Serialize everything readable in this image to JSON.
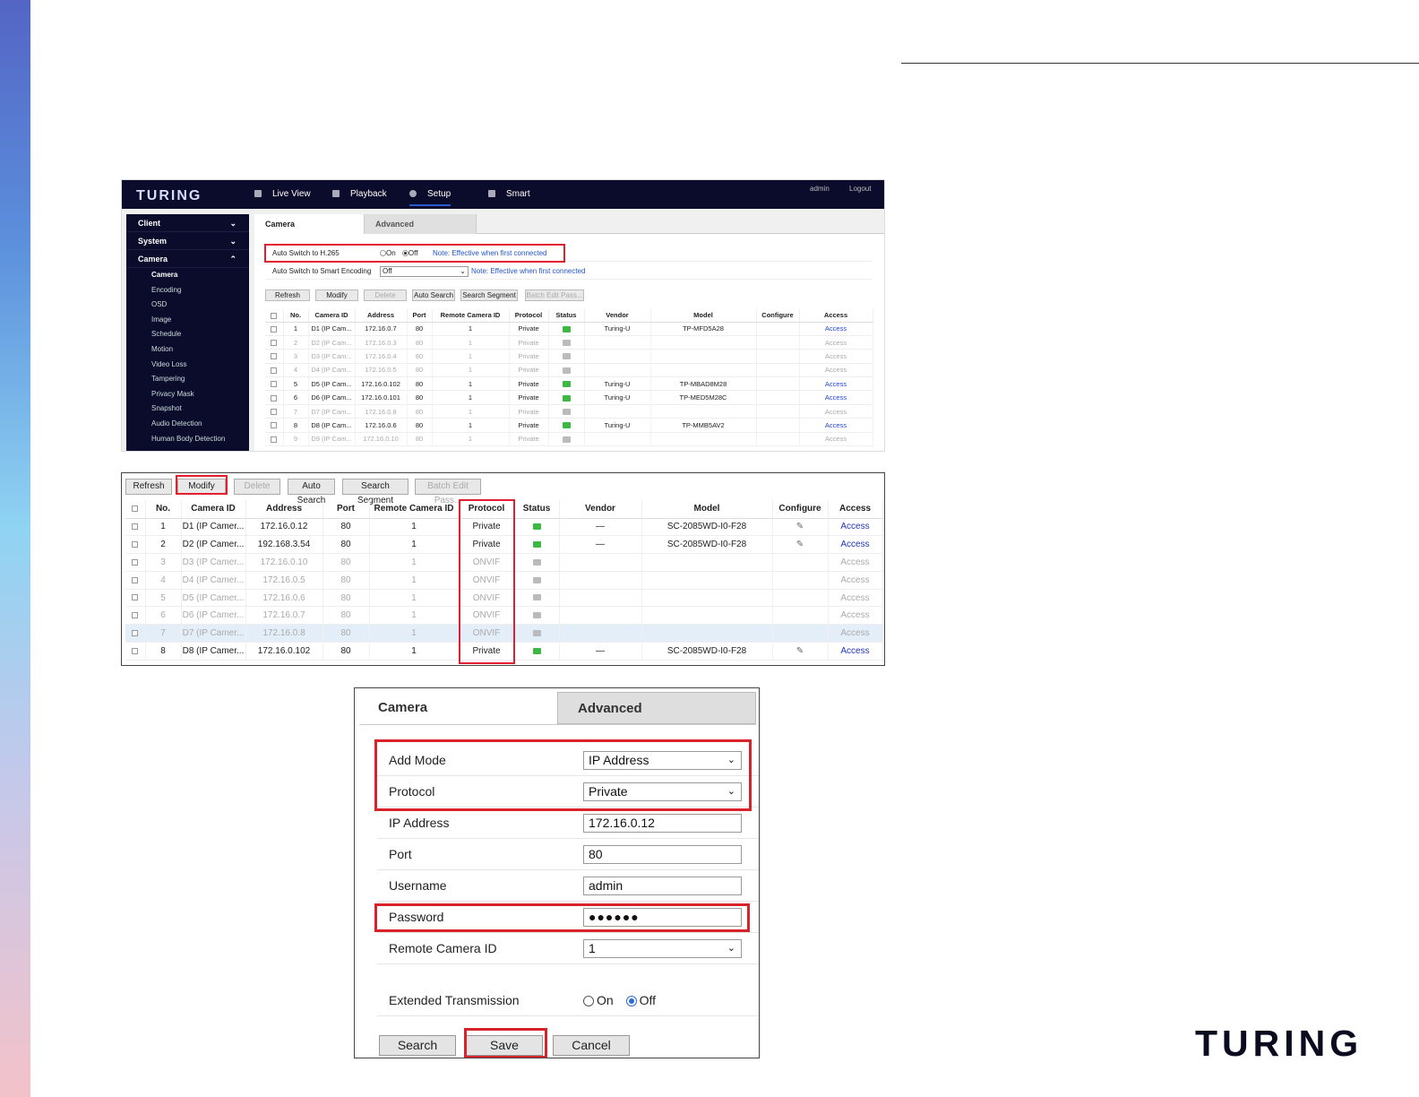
{
  "panel1": {
    "logo": "TURING",
    "nav": [
      "Live View",
      "Playback",
      "Setup",
      "Smart"
    ],
    "header_right": [
      "admin",
      "Logout"
    ],
    "sidebar": {
      "sections": [
        "Client",
        "System",
        "Camera"
      ],
      "camera_items": [
        "Camera",
        "Encoding",
        "OSD",
        "Image",
        "Schedule",
        "Motion",
        "Video Loss",
        "Tampering",
        "Privacy Mask",
        "Snapshot",
        "Audio Detection",
        "Human Body Detection"
      ]
    },
    "tabs": [
      "Camera",
      "Advanced"
    ],
    "settings": {
      "h265_label": "Auto Switch to H.265",
      "on": "On",
      "off": "Off",
      "note": "Note: Effective when first connected",
      "smart_label": "Auto Switch to Smart Encoding",
      "smart_value": "Off"
    },
    "toolbar": [
      "Refresh",
      "Modify",
      "Delete",
      "Auto Search",
      "Search Segment",
      "Batch Edit Pass..."
    ],
    "columns": [
      "",
      "No.",
      "Camera ID",
      "Address",
      "Port",
      "Remote Camera ID",
      "Protocol",
      "Status",
      "Vendor",
      "Model",
      "Configure",
      "Access"
    ],
    "rows": [
      {
        "no": "1",
        "id": "D1 (IP Cam...",
        "address": "172.16.0.7",
        "port": "80",
        "rid": "1",
        "protocol": "Private",
        "vendor": "Turing-U",
        "model": "TP-MFD5A28",
        "access": "Access",
        "active": true
      },
      {
        "no": "2",
        "id": "D2 (IP Cam...",
        "address": "172.16.0.3",
        "port": "80",
        "rid": "1",
        "protocol": "Private",
        "vendor": "",
        "model": "",
        "access": "Access",
        "active": false
      },
      {
        "no": "3",
        "id": "D3 (IP Cam...",
        "address": "172.16.0.4",
        "port": "80",
        "rid": "1",
        "protocol": "Private",
        "vendor": "",
        "model": "",
        "access": "Access",
        "active": false
      },
      {
        "no": "4",
        "id": "D4 (IP Cam...",
        "address": "172.16.0.5",
        "port": "80",
        "rid": "1",
        "protocol": "Private",
        "vendor": "",
        "model": "",
        "access": "Access",
        "active": false
      },
      {
        "no": "5",
        "id": "D5 (IP Cam...",
        "address": "172.16.0.102",
        "port": "80",
        "rid": "1",
        "protocol": "Private",
        "vendor": "Turing-U",
        "model": "TP-MBAD8M28",
        "access": "Access",
        "active": true
      },
      {
        "no": "6",
        "id": "D6 (IP Cam...",
        "address": "172.16.0.101",
        "port": "80",
        "rid": "1",
        "protocol": "Private",
        "vendor": "Turing-U",
        "model": "TP-MED5M28C",
        "access": "Access",
        "active": true
      },
      {
        "no": "7",
        "id": "D7 (IP Cam...",
        "address": "172.16.0.8",
        "port": "80",
        "rid": "1",
        "protocol": "Private",
        "vendor": "",
        "model": "",
        "access": "Access",
        "active": false
      },
      {
        "no": "8",
        "id": "D8 (IP Cam...",
        "address": "172.16.0.6",
        "port": "80",
        "rid": "1",
        "protocol": "Private",
        "vendor": "Turing-U",
        "model": "TP-MMB5AV2",
        "access": "Access",
        "active": true
      },
      {
        "no": "9",
        "id": "D9 (IP Cam...",
        "address": "172.16.0.10",
        "port": "80",
        "rid": "1",
        "protocol": "Private",
        "vendor": "",
        "model": "",
        "access": "Access",
        "active": false
      }
    ]
  },
  "panel2": {
    "toolbar": [
      "Refresh",
      "Modify",
      "Delete",
      "Auto Search",
      "Search Segment",
      "Batch Edit Pass..."
    ],
    "columns": [
      "",
      "No.",
      "Camera ID",
      "Address",
      "Port",
      "Remote Camera ID",
      "Protocol",
      "Status",
      "Vendor",
      "Model",
      "Configure",
      "Access"
    ],
    "rows": [
      {
        "no": "1",
        "id": "D1 (IP Camer...",
        "address": "172.16.0.12",
        "port": "80",
        "rid": "1",
        "protocol": "Private",
        "vendor": "—",
        "model": "SC-2085WD-I0-F28",
        "access": "Access",
        "active": true,
        "config": true
      },
      {
        "no": "2",
        "id": "D2 (IP Camer...",
        "address": "192.168.3.54",
        "port": "80",
        "rid": "1",
        "protocol": "Private",
        "vendor": "—",
        "model": "SC-2085WD-I0-F28",
        "access": "Access",
        "active": true,
        "config": true
      },
      {
        "no": "3",
        "id": "D3 (IP Camer...",
        "address": "172.16.0.10",
        "port": "80",
        "rid": "1",
        "protocol": "ONVIF",
        "vendor": "",
        "model": "",
        "access": "Access",
        "active": false,
        "config": false
      },
      {
        "no": "4",
        "id": "D4 (IP Camer...",
        "address": "172.16.0.5",
        "port": "80",
        "rid": "1",
        "protocol": "ONVIF",
        "vendor": "",
        "model": "",
        "access": "Access",
        "active": false,
        "config": false
      },
      {
        "no": "5",
        "id": "D5 (IP Camer...",
        "address": "172.16.0.6",
        "port": "80",
        "rid": "1",
        "protocol": "ONVIF",
        "vendor": "",
        "model": "",
        "access": "Access",
        "active": false,
        "config": false
      },
      {
        "no": "6",
        "id": "D6 (IP Camer...",
        "address": "172.16.0.7",
        "port": "80",
        "rid": "1",
        "protocol": "ONVIF",
        "vendor": "",
        "model": "",
        "access": "Access",
        "active": false,
        "config": false
      },
      {
        "no": "7",
        "id": "D7 (IP Camer...",
        "address": "172.16.0.8",
        "port": "80",
        "rid": "1",
        "protocol": "ONVIF",
        "vendor": "",
        "model": "",
        "access": "Access",
        "active": false,
        "config": false,
        "highlight": true
      },
      {
        "no": "8",
        "id": "D8 (IP Camer...",
        "address": "172.16.0.102",
        "port": "80",
        "rid": "1",
        "protocol": "Private",
        "vendor": "—",
        "model": "SC-2085WD-I0-F28",
        "access": "Access",
        "active": true,
        "config": true
      }
    ]
  },
  "panel3": {
    "tabs": [
      "Camera",
      "Advanced"
    ],
    "fields": {
      "add_mode_label": "Add Mode",
      "add_mode_value": "IP Address",
      "protocol_label": "Protocol",
      "protocol_value": "Private",
      "ip_label": "IP Address",
      "ip_value": "172.16.0.12",
      "port_label": "Port",
      "port_value": "80",
      "username_label": "Username",
      "username_value": "admin",
      "password_label": "Password",
      "password_value": "●●●●●●",
      "rcid_label": "Remote Camera ID",
      "rcid_value": "1",
      "ext_label": "Extended Transmission",
      "ext_on": "On",
      "ext_off": "Off"
    },
    "buttons": [
      "Search",
      "Save",
      "Cancel"
    ]
  },
  "brand_logo": "TURING"
}
